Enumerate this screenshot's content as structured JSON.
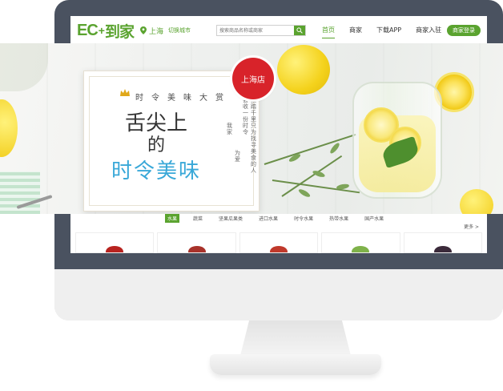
{
  "header": {
    "logo_latin": "EC",
    "logo_plus": "+",
    "logo_cn": "到家",
    "location": "上海",
    "switch_city": "切换城市",
    "search_placeholder": "搜索商品名称或商家",
    "nav": [
      "首页",
      "商家",
      "下载APP",
      "商家入驻"
    ],
    "login": "商家登录"
  },
  "banner": {
    "subtitle_chars": [
      "时",
      "令",
      "美",
      "味",
      "大",
      "赏"
    ],
    "title_line1": "舌尖上",
    "title_line2": "的",
    "title_line3": "时令美味",
    "poem_columns": [
      "给挂踏千里只为找寻美食的人",
      "都会收一份时令",
      "为爱",
      "我家"
    ],
    "badge": "上海店"
  },
  "categories": {
    "tabs": [
      "水果",
      "蔬菜",
      "坚果瓜果类",
      "进口水果",
      "时令水果",
      "热带水果",
      "国产水果"
    ],
    "more": "更多 >"
  },
  "colors": {
    "brand": "#5aa32f",
    "badge": "#d8232a",
    "accent_text": "#39a8d8"
  }
}
